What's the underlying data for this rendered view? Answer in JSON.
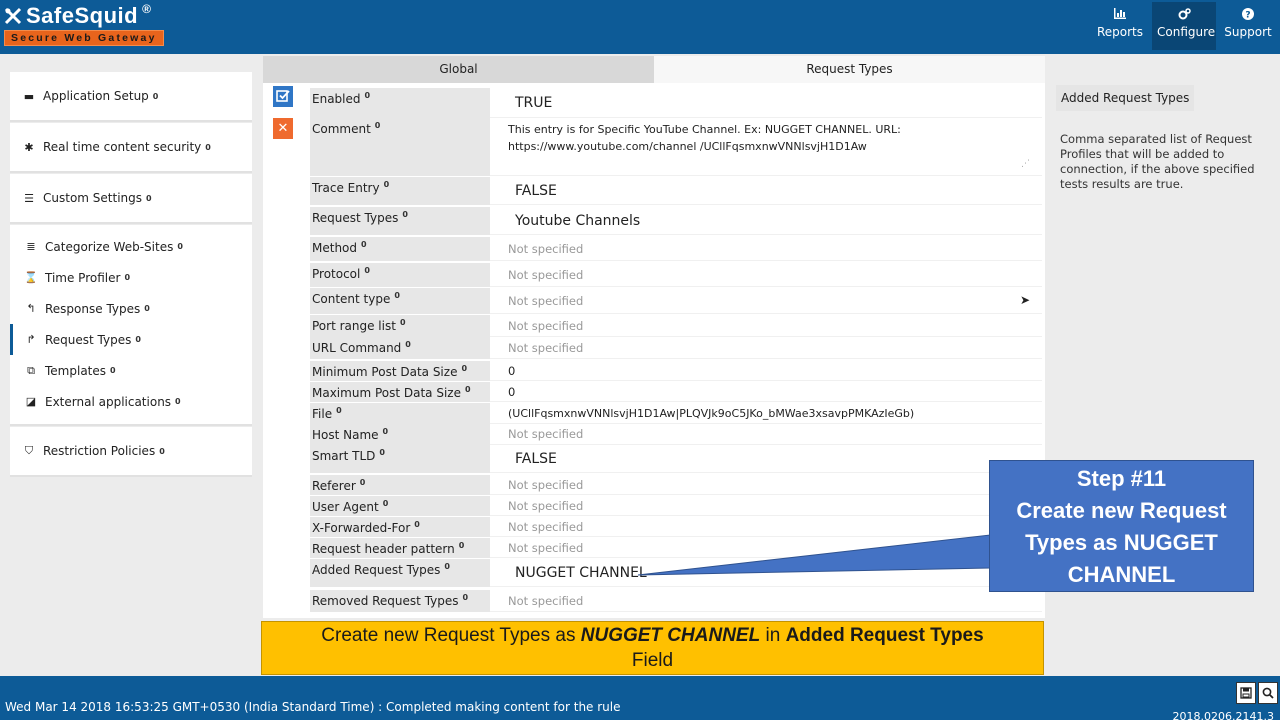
{
  "app": {
    "name": "SafeSquid",
    "registered": "®",
    "tagline": "Secure Web Gateway"
  },
  "nav": [
    {
      "label": "Reports",
      "icon": "bar-chart-icon"
    },
    {
      "label": "Configure",
      "icon": "cogs-icon"
    },
    {
      "label": "Support",
      "icon": "question-icon"
    }
  ],
  "sidebar": {
    "top": [
      {
        "label": "Application Setup",
        "icon": "briefcase-icon"
      },
      {
        "label": "Real time content security",
        "icon": "bug-icon"
      },
      {
        "label": "Custom Settings",
        "icon": "sliders-icon"
      }
    ],
    "sub": [
      {
        "label": "Categorize Web-Sites",
        "icon": "database-icon"
      },
      {
        "label": "Time Profiler",
        "icon": "hourglass-icon"
      },
      {
        "label": "Response Types",
        "icon": "reply-icon"
      },
      {
        "label": "Request Types",
        "icon": "share-icon"
      },
      {
        "label": "Templates",
        "icon": "templates-icon"
      },
      {
        "label": "External applications",
        "icon": "external-icon"
      }
    ],
    "bottom": [
      {
        "label": "Restriction Policies",
        "icon": "shield-icon"
      }
    ],
    "info_mark": "0"
  },
  "tabs": {
    "global": "Global",
    "request_types": "Request Types"
  },
  "fields": {
    "enabled": {
      "label": "Enabled",
      "value": "TRUE"
    },
    "comment": {
      "label": "Comment",
      "value": "This entry is for Specific YouTube Channel.  Ex: NUGGET CHANNEL.   URL: https://www.youtube.com/channel /UCllFqsmxnwVNNlsvjH1D1Aw"
    },
    "trace_entry": {
      "label": "Trace Entry",
      "value": "FALSE"
    },
    "request_types": {
      "label": "Request Types",
      "value": "Youtube Channels"
    },
    "method": {
      "label": "Method",
      "value": "Not specified"
    },
    "protocol": {
      "label": "Protocol",
      "value": "Not specified"
    },
    "content_type": {
      "label": "Content type",
      "value": "Not specified"
    },
    "port_range": {
      "label": "Port range list",
      "value": "Not specified"
    },
    "url_command": {
      "label": "URL Command",
      "value": "Not specified"
    },
    "min_post": {
      "label": "Minimum Post Data Size",
      "value": "0"
    },
    "max_post": {
      "label": "Maximum Post Data Size",
      "value": "0"
    },
    "file": {
      "label": "File",
      "value": "(UCllFqsmxnwVNNlsvjH1D1Aw|PLQVJk9oC5JKo_bMWae3xsavpPMKAzIeGb)"
    },
    "host_name": {
      "label": "Host Name",
      "value": "Not specified"
    },
    "smart_tld": {
      "label": "Smart TLD",
      "value": "FALSE"
    },
    "referer": {
      "label": "Referer",
      "value": "Not specified"
    },
    "user_agent": {
      "label": "User Agent",
      "value": "Not specified"
    },
    "x_forwarded": {
      "label": "X-Forwarded-For",
      "value": "Not specified"
    },
    "req_header": {
      "label": "Request header pattern",
      "value": "Not specified"
    },
    "added_req": {
      "label": "Added Request Types",
      "value": "NUGGET CHANNEL"
    },
    "removed_req": {
      "label": "Removed Request Types",
      "value": "Not specified"
    }
  },
  "help": {
    "title": "Added Request Types",
    "text": "Comma separated list of Request Profiles that will be added to connection, if the above specified tests results are true."
  },
  "callout": {
    "line1": "Step #11",
    "line2": "Create new Request",
    "line3": "Types as NUGGET",
    "line4": "CHANNEL"
  },
  "banner": {
    "part1": "Create new Request Types as ",
    "part2": "NUGGET CHANNEL",
    "part3": " in ",
    "part4": "Added Request Types",
    "part5": "Field"
  },
  "footer": {
    "status": "Wed Mar 14 2018 16:53:25 GMT+0530 (India Standard Time) : Completed making content for the rule",
    "version": "2018.0206.2141.3"
  },
  "colors": {
    "header": "#0d5b97",
    "accent_orange": "#e8641c",
    "callout": "#4472c4",
    "banner": "#ffc000"
  }
}
